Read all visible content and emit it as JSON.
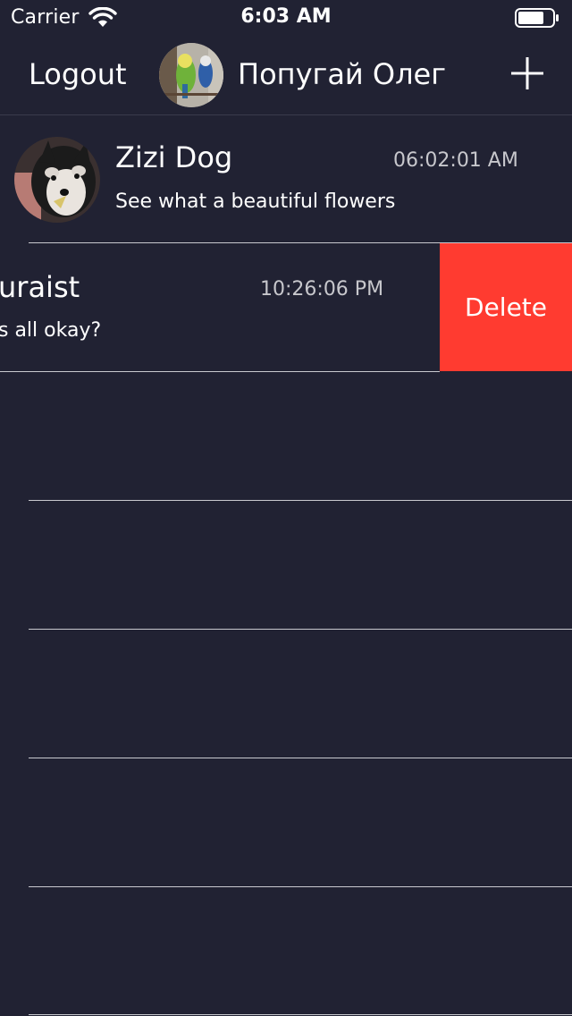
{
  "status_bar": {
    "carrier": "Carrier",
    "time": "6:03 AM"
  },
  "nav": {
    "logout_label": "Logout",
    "title": "Попугай Олег"
  },
  "chats": [
    {
      "name": "Zizi Dog",
      "time": "06:02:01 AM",
      "message": "See what a beautiful flowers"
    },
    {
      "name": "uraist",
      "time": "10:26:06 PM",
      "message": "s all okay?",
      "delete_label": "Delete"
    }
  ],
  "colors": {
    "background": "#212233",
    "delete": "#ff3b30",
    "separator": "#c9c9cf",
    "secondary_text": "#c7c7cc"
  }
}
